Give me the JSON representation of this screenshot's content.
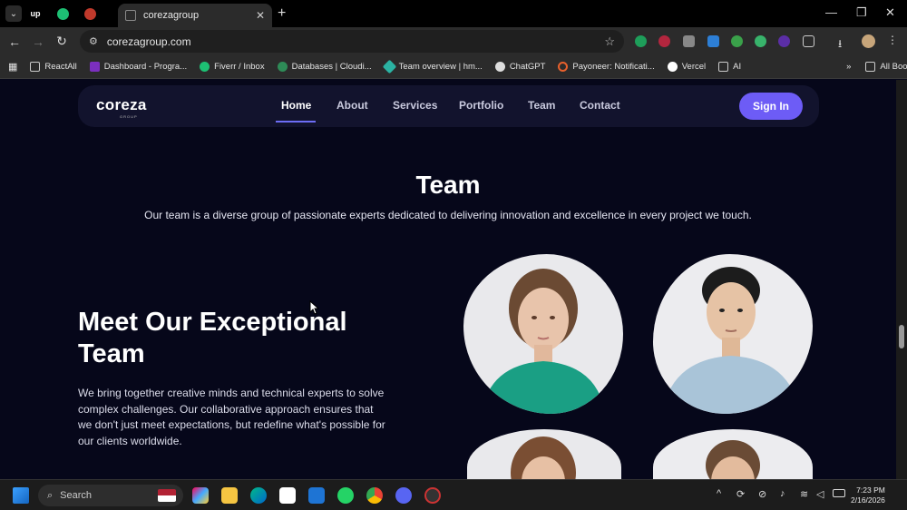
{
  "browser": {
    "pinned_tabs": [
      "up"
    ],
    "active_tab_title": "corezagroup",
    "url": "corezagroup.com",
    "bookmarks": [
      "ReactAll",
      "Dashboard - Progra...",
      "Fiverr / Inbox",
      "Databases | Cloudi...",
      "Team overview | hm...",
      "ChatGPT",
      "Payoneer: Notificati...",
      "Vercel",
      "AI"
    ],
    "all_bookmarks": "All Bookmarks",
    "more_chevron": "»"
  },
  "site": {
    "logo": "coreza",
    "logo_sub": "GROUP",
    "nav": [
      "Home",
      "About",
      "Services",
      "Portfolio",
      "Team",
      "Contact"
    ],
    "active_nav": "Home",
    "signin": "Sign In",
    "team_title": "Team",
    "team_subtitle": "Our team is a diverse group of passionate experts dedicated to delivering innovation and excellence in every project we touch.",
    "meet_title_line1": "Meet Our Exceptional",
    "meet_title_line2": "Team",
    "meet_description": "We bring together creative minds and technical experts to solve complex challenges. Our collaborative approach ensures that we don't just meet expectations, but redefine what's possible for our clients worldwide."
  },
  "taskbar": {
    "search_placeholder": "Search",
    "time": "7:23 PM",
    "date": "2/16/2026"
  },
  "colors": {
    "accent": "#6d5cf6",
    "page_bg": "#06071a",
    "navbar_bg": "#12132d"
  }
}
